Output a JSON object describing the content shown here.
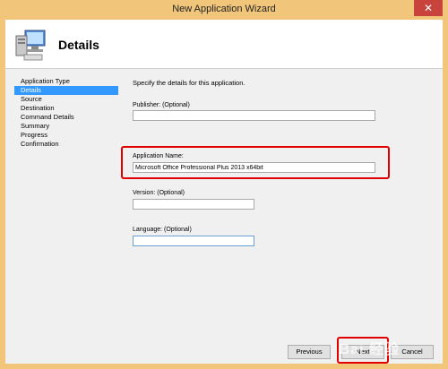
{
  "window": {
    "title": "New Application Wizard",
    "close_glyph": "✕"
  },
  "header": {
    "title": "Details",
    "icon": "computer-icon"
  },
  "nav": {
    "items": [
      {
        "label": "Application Type",
        "active": false
      },
      {
        "label": "Details",
        "active": true
      },
      {
        "label": "Source",
        "active": false
      },
      {
        "label": "Destination",
        "active": false
      },
      {
        "label": "Command Details",
        "active": false
      },
      {
        "label": "Summary",
        "active": false
      },
      {
        "label": "Progress",
        "active": false
      },
      {
        "label": "Confirmation",
        "active": false
      }
    ]
  },
  "form": {
    "intro": "Specify the details for this application.",
    "publisher": {
      "label": "Publisher: (Optional)",
      "value": ""
    },
    "app_name": {
      "label": "Application Name:",
      "value": "Microsoft Office Professional Plus 2013 x64bit"
    },
    "version": {
      "label": "Version: (Optional)",
      "value": ""
    },
    "language": {
      "label": "Language: (Optional)",
      "value": ""
    }
  },
  "buttons": {
    "previous": "Previous",
    "next": "Next",
    "cancel": "Cancel"
  },
  "watermark": "Bai 经验",
  "colors": {
    "title_bar": "#f1c67a",
    "selection": "#3399ff",
    "highlight_box": "#e00000"
  }
}
